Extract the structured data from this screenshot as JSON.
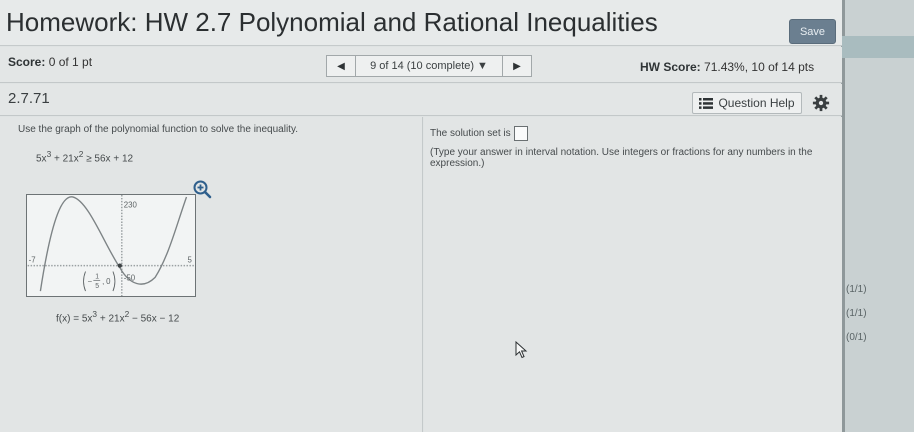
{
  "header": {
    "title": "Homework: HW 2.7 Polynomial and Rational Inequalities",
    "save_label": "Save"
  },
  "score_bar": {
    "score_label": "Score:",
    "score_value": "0 of 1 pt",
    "nav_selected": "9 of 14 (10 complete)",
    "hw_score_label": "HW Score:",
    "hw_score_value": "71.43%, 10 of 14 pts"
  },
  "problem": {
    "number": "2.7.71",
    "question_help_label": "Question Help"
  },
  "left_pane": {
    "instruction": "Use the graph of the polynomial function to solve the inequality.",
    "inequality_tail": "≥ 56x + 12",
    "function_label_prefix": "f(x) = 5x",
    "function_label_tail": " − 56x − 12"
  },
  "graph": {
    "y_max_label": "230",
    "y_min_label": "-50",
    "x_min_label": "-7",
    "x_max_label": "5",
    "point_x_num": "1",
    "point_x_den": "5",
    "point_y": "0"
  },
  "right_pane": {
    "solution_prefix": "The solution set is",
    "hint": "(Type your answer in interval notation. Use integers or fractions for any numbers in the expression.)"
  },
  "background_scores": [
    "(1/1)",
    "(1/1)",
    "(0/1)"
  ],
  "icons": {
    "zoom": "zoom-in-icon",
    "help": "list-icon",
    "settings": "gear-icon",
    "cursor": "mouse-cursor-icon"
  },
  "colors": {
    "save_button": "#6b7f90",
    "zoom_icon": "#2f5f8c"
  }
}
